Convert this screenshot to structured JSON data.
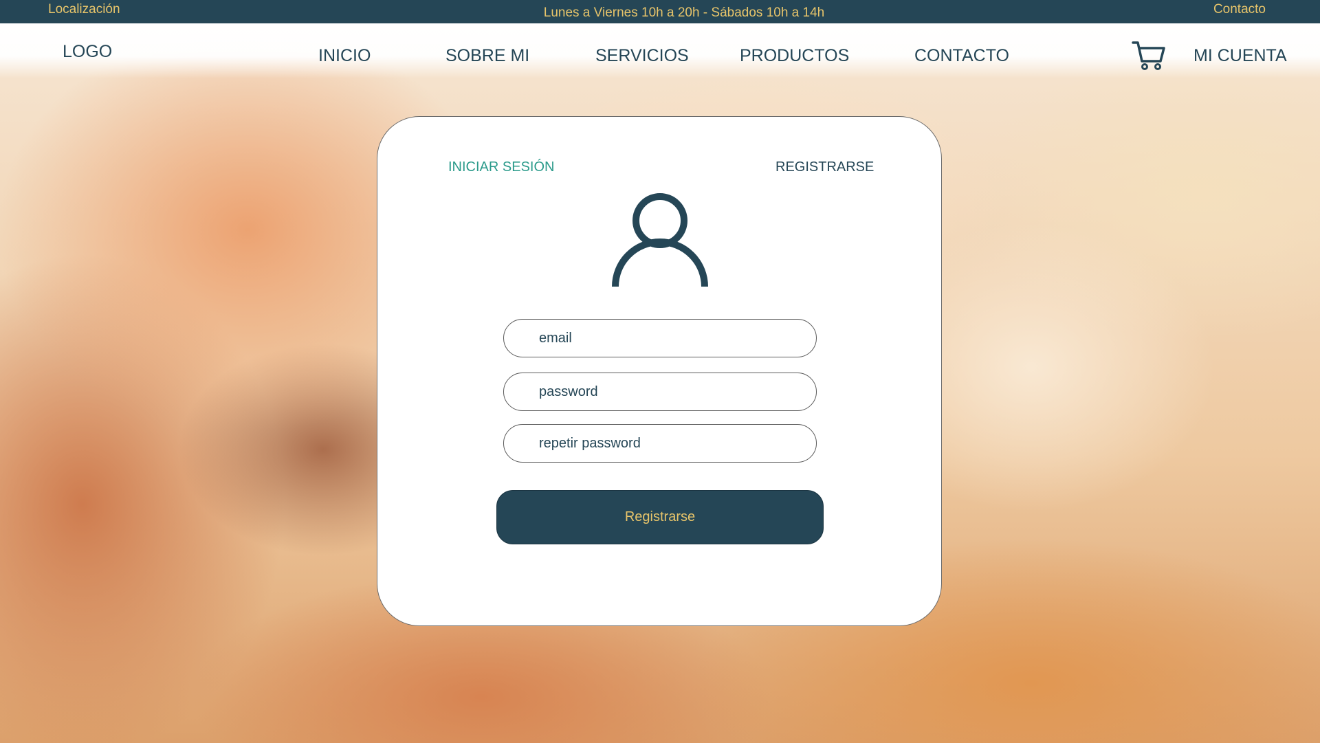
{
  "topbar": {
    "location": "Localización",
    "hours": "Lunes a Viernes 10h a 20h - Sábados 10h a 14h",
    "contact": "Contacto"
  },
  "navbar": {
    "logo": "LOGO",
    "items": [
      "INICIO",
      "SOBRE MI",
      "SERVICIOS",
      "PRODUCTOS",
      "CONTACTO"
    ],
    "cart_icon": "shopping-cart-icon",
    "account": "MI CUENTA"
  },
  "card": {
    "tabs": {
      "login": "INICIAR SESIÓN",
      "register": "REGISTRARSE"
    },
    "user_icon": "user-icon",
    "fields": {
      "email_placeholder": "email",
      "password_placeholder": "password",
      "repeat_password_placeholder": "repetir password"
    },
    "submit_label": "Registrarse"
  },
  "colors": {
    "primary": "#254656",
    "accent": "#e7c46a",
    "active_tab": "#2a9a8a"
  }
}
